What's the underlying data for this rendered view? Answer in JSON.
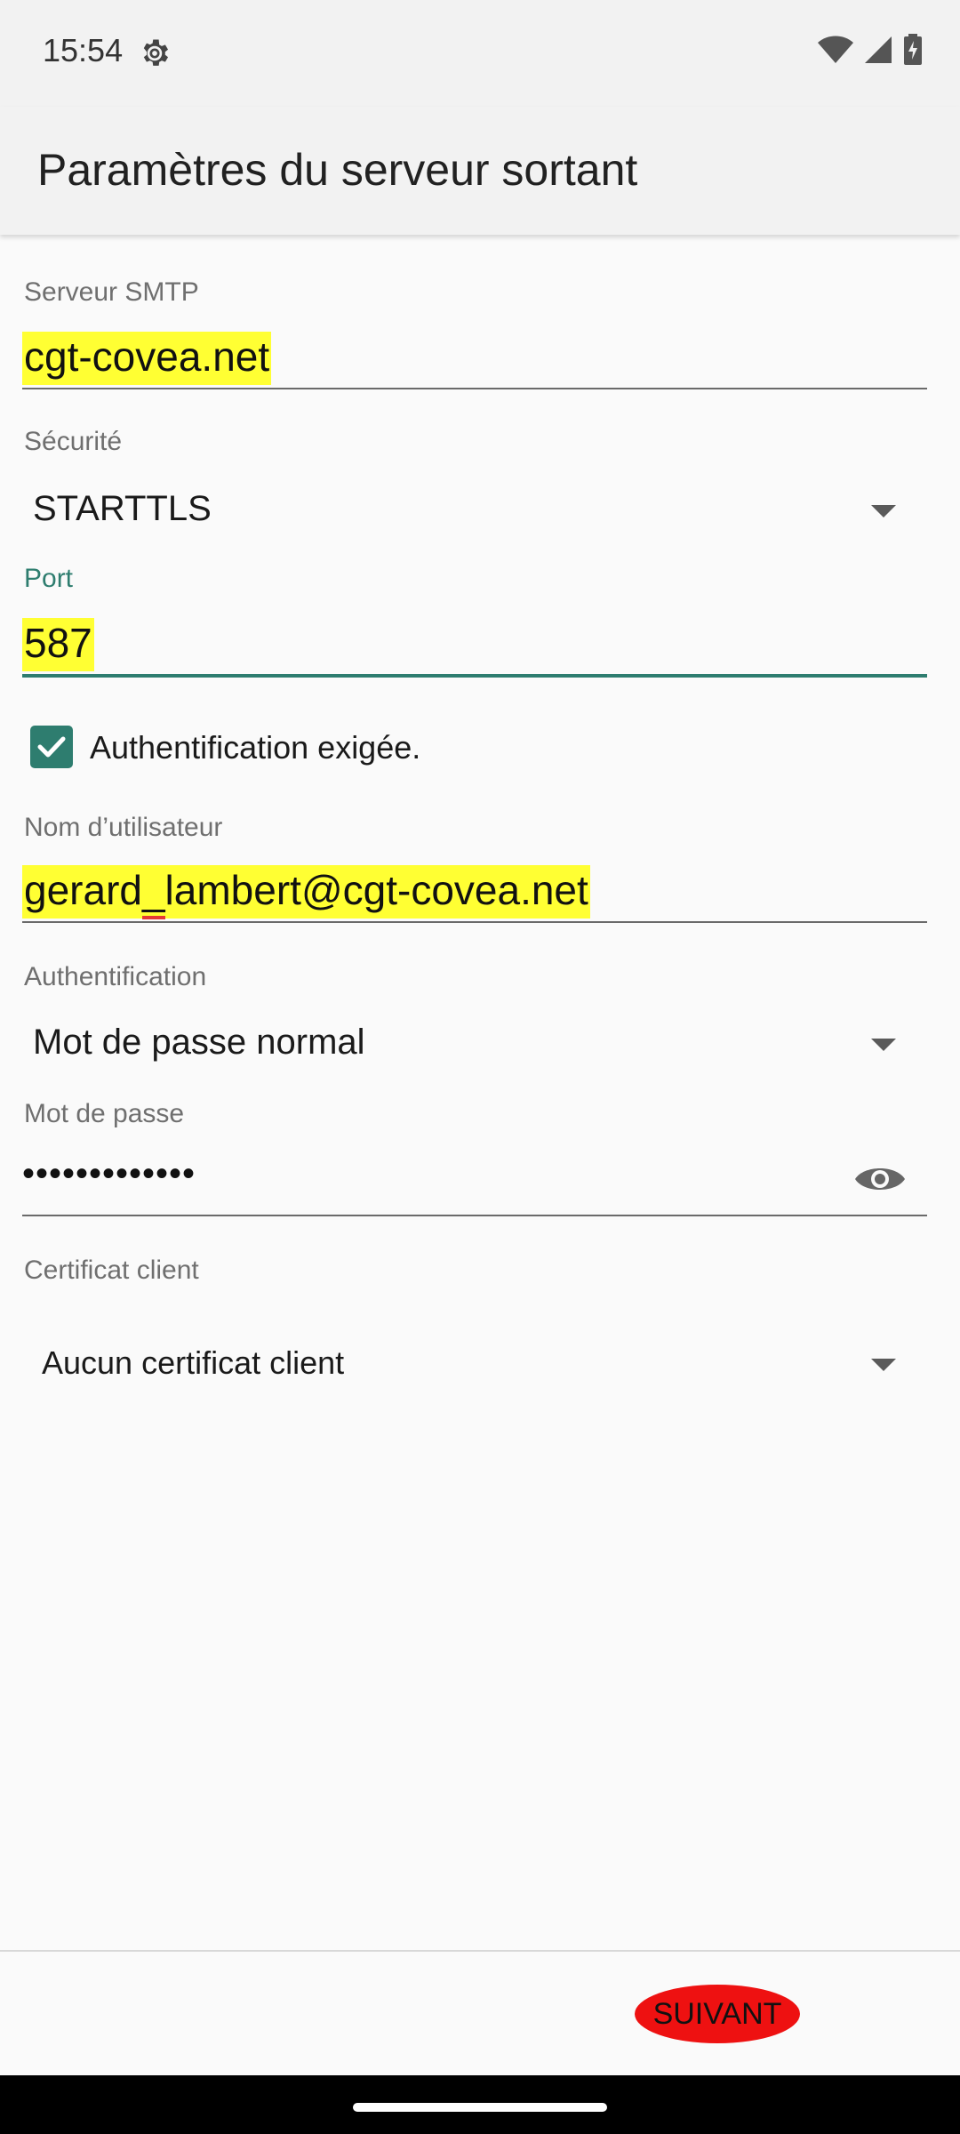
{
  "status_bar": {
    "time": "15:54"
  },
  "app_bar": {
    "title": "Paramètres du serveur sortant"
  },
  "form": {
    "smtp_server": {
      "label": "Serveur SMTP",
      "value": "cgt-covea.net"
    },
    "security": {
      "label": "Sécurité",
      "value": "STARTTLS"
    },
    "port": {
      "label": "Port",
      "value": "587"
    },
    "auth_required": {
      "label": "Authentification exigée.",
      "checked": true
    },
    "username": {
      "label": "Nom d’utilisateur",
      "value": "gerard_lambert@cgt-covea.net"
    },
    "authentication": {
      "label": "Authentification",
      "value": "Mot de passe normal"
    },
    "password": {
      "label": "Mot de passe",
      "masked_value": "•••••••••••••"
    },
    "client_certificate": {
      "label": "Certificat client",
      "value": "Aucun certificat client"
    }
  },
  "footer": {
    "next_label": "SUIVANT"
  },
  "colors": {
    "accent": "#2e7d6f",
    "highlight": "#ffff33",
    "next_button": "#ee1111"
  },
  "icons": {
    "status_settings": "gear-icon",
    "wifi": "wifi-icon",
    "signal": "signal-icon",
    "battery": "battery-charging-icon",
    "password_visibility": "eye-icon",
    "checkbox": "check-icon",
    "dropdown": "dropdown-caret-icon"
  }
}
